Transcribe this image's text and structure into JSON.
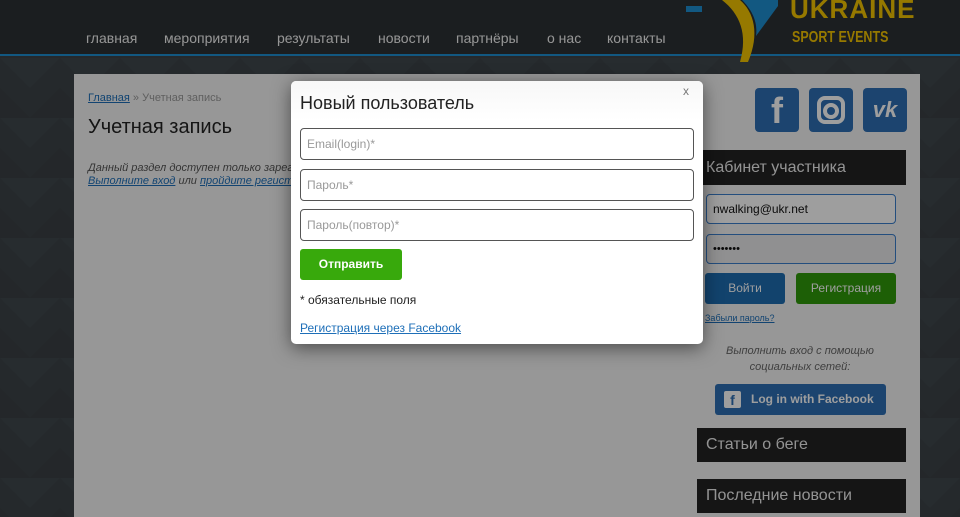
{
  "nav": {
    "items": [
      "главная",
      "мероприятия",
      "результаты",
      "новости",
      "партнёры",
      "о нас",
      "контакты"
    ]
  },
  "logo": {
    "line1": "UKRAINE",
    "line2": "SPORT EVENTS",
    "colors": {
      "yellow": "#f2c300",
      "blue": "#1e8fd1"
    }
  },
  "page": {
    "breadcrumb_home": "Главная",
    "breadcrumb_sep": " » ",
    "breadcrumb_current": "Учетная запись",
    "title": "Учетная запись",
    "notice_line1": "Данный раздел доступен только зарег",
    "notice_login": "Выполните вход",
    "notice_or": " или ",
    "notice_register": "пройдите регистр"
  },
  "social": {
    "icons": [
      "facebook-icon",
      "instagram-icon",
      "vk-icon"
    ],
    "fb_glyph": "f",
    "vk_glyph": "vk"
  },
  "sidebar": {
    "cabinet_title": "Кабинет участника",
    "email_value": "nwalking@ukr.net",
    "password_value": "•••••••",
    "login_label": "Войти",
    "register_label": "Регистрация",
    "forgot_label": "Забыли пароль?",
    "social_note": "Выполнить вход с помощью социальных сетей:",
    "fb_login_label": "Log in with Facebook",
    "articles_title": "Статьи о беге",
    "news_title": "Последние новости"
  },
  "modal": {
    "title": "Новый пользователь",
    "close_label": "x",
    "email_placeholder": "Email(login)*",
    "password_placeholder": "Пароль*",
    "password_repeat_placeholder": "Пароль(повтор)*",
    "submit_label": "Отправить",
    "required_note": "* обязательные поля",
    "facebook_register_label": "Регистрация через Facebook"
  },
  "colors": {
    "accent_blue": "#1e8fd1",
    "submit_green": "#38a90c",
    "register_green": "#2f9a0a",
    "login_blue": "#1d6cb0"
  }
}
